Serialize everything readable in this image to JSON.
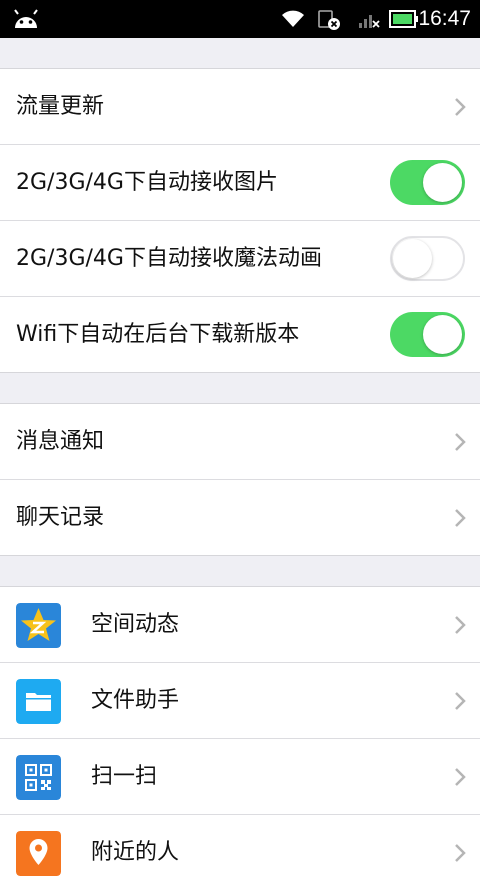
{
  "status_bar": {
    "time": "16:47",
    "icons": [
      "android-icon",
      "wifi-icon",
      "sim-card-icon",
      "signal-icon",
      "battery-icon"
    ]
  },
  "section1": {
    "items": [
      {
        "label": "流量更新",
        "type": "link"
      },
      {
        "label": "2G/3G/4G下自动接收图片",
        "type": "toggle",
        "on": true
      },
      {
        "label": "2G/3G/4G下自动接收魔法动画",
        "type": "toggle",
        "on": false
      },
      {
        "label": "Wifi下自动在后台下载新版本",
        "type": "toggle",
        "on": true
      }
    ]
  },
  "section2": {
    "items": [
      {
        "label": "消息通知",
        "type": "link"
      },
      {
        "label": "聊天记录",
        "type": "link"
      }
    ]
  },
  "section3": {
    "items": [
      {
        "label": "空间动态",
        "icon": "qzone-star-icon",
        "color": "#2a86d9"
      },
      {
        "label": "文件助手",
        "icon": "folder-icon",
        "color": "#1eaaf1"
      },
      {
        "label": "扫一扫",
        "icon": "qr-code-icon",
        "color": "#2a86d9"
      },
      {
        "label": "附近的人",
        "icon": "location-pin-icon",
        "color": "#f5751f"
      }
    ]
  },
  "colors": {
    "toggle_on": "#4cd964",
    "background": "#efeff4",
    "chevron": "#b5b5b5"
  }
}
